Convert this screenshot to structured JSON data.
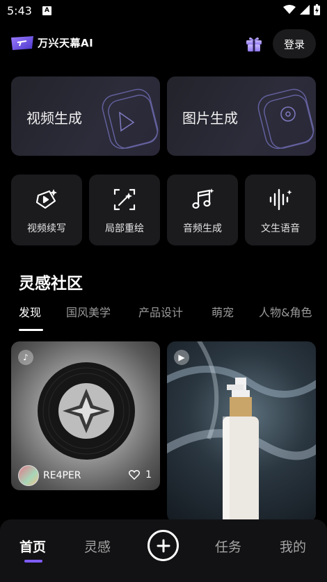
{
  "status_bar": {
    "time": "5:43",
    "notification_icon": "A"
  },
  "header": {
    "app_name": "万兴天幕AI",
    "login_label": "登录"
  },
  "big_cards": [
    {
      "label": "视频生成",
      "icon": "video-play-icon"
    },
    {
      "label": "图片生成",
      "icon": "image-icon"
    }
  ],
  "tools": [
    {
      "label": "视频续写",
      "icon": "video-extend-icon"
    },
    {
      "label": "局部重绘",
      "icon": "inpaint-icon"
    },
    {
      "label": "音频生成",
      "icon": "music-note-icon"
    },
    {
      "label": "文生语音",
      "icon": "voice-wave-icon"
    }
  ],
  "community": {
    "title": "灵感社区",
    "tabs": [
      "发现",
      "国风美学",
      "产品设计",
      "萌宠",
      "人物&角色"
    ],
    "active_tab": "发现"
  },
  "feed": [
    {
      "author": "RE4PER",
      "likes": "1",
      "type_icon": "tiktok-icon"
    },
    {
      "type_icon": "play-icon"
    }
  ],
  "bottom_nav": {
    "items": [
      "首页",
      "灵感",
      "任务",
      "我的"
    ],
    "active": "首页"
  },
  "colors": {
    "accent": "#7f5cff",
    "background": "#000000"
  }
}
